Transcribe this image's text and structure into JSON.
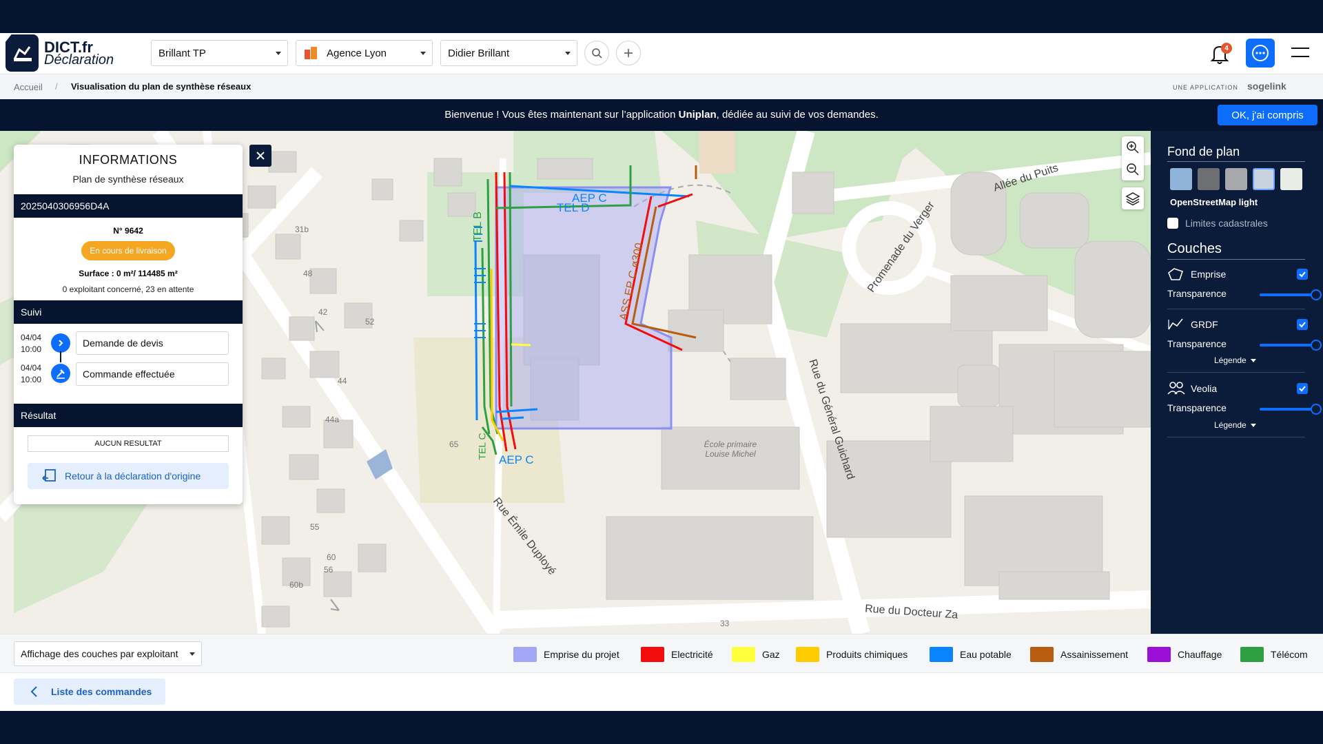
{
  "header": {
    "logo_title": "DICT.fr",
    "logo_subtitle": "Déclaration",
    "company_select": "Brillant TP",
    "agency_select": "Agence Lyon",
    "user_select": "Didier Brillant",
    "notification_count": "4"
  },
  "breadcrumb": {
    "home": "Accueil",
    "separator": "/",
    "current": "Visualisation du plan de synthèse réseaux",
    "app_prefix": "UNE APPLICATION",
    "brand": "sogelink"
  },
  "banner": {
    "message_before": "Bienvenue ! Vous êtes maintenant sur l’application ",
    "message_app": "Uniplan",
    "message_after": ", dédiée au suivi de vos demandes.",
    "ok_button": "OK, j'ai compris"
  },
  "map": {
    "street_labels": [
      "Allée du Puits",
      "Promenade du Verger",
      "Rue du Général Guichard",
      "Rue Émile Duployé",
      "Rue du Docteur Za"
    ],
    "poi_label": "École primaire Louise Michel",
    "building_numbers": [
      "31b",
      "48",
      "42",
      "52",
      "44",
      "44a",
      "55",
      "65",
      "56",
      "60",
      "60b",
      "33"
    ],
    "network_labels": [
      "AEP C",
      "TEL D",
      "TEL B",
      "ASS EP C ø300",
      "AEP C",
      "TEL C"
    ]
  },
  "info_panel": {
    "title": "INFORMATIONS",
    "subtitle": "Plan de synthèse réseaux",
    "reference": "2025040306956D4A",
    "number": "N° 9642",
    "status": "En cours de livraison",
    "status_color": "#f5a623",
    "surface": "Surface : 0 m²/ 114485 m²",
    "operators": "0 exploitant concerné, 23 en attente",
    "suivi_title": "Suivi",
    "timeline": [
      {
        "date": "04/04",
        "time": "10:00",
        "label": "Demande de devis"
      },
      {
        "date": "04/04",
        "time": "10:00",
        "label": "Commande effectuée"
      }
    ],
    "result_title": "Résultat",
    "result_value": "AUCUN RESULTAT",
    "back_button": "Retour à la déclaration d'origine"
  },
  "sidebar": {
    "basemap_title": "Fond de plan",
    "basemap_selected": "OpenStreetMap light",
    "cadastre_label": "Limites cadastrales",
    "layers_title": "Couches",
    "layers": [
      {
        "name": "Emprise",
        "checked": true,
        "transparency_label": "Transparence",
        "transparency": 1.0
      },
      {
        "name": "GRDF",
        "checked": true,
        "transparency_label": "Transparence",
        "transparency": 1.0,
        "legend": "Légende"
      },
      {
        "name": "Veolia",
        "checked": true,
        "transparency_label": "Transparence",
        "transparency": 1.0,
        "legend": "Légende"
      }
    ]
  },
  "legend_bar": {
    "display_select": "Affichage des couches par exploitant",
    "items": [
      {
        "label": "Emprise du projet",
        "color": "#a3a6f5"
      },
      {
        "label": "Electricité",
        "color": "#f40b0b"
      },
      {
        "label": "Gaz",
        "color": "#ffff3c"
      },
      {
        "label": "Produits chimiques",
        "color": "#ffcc00"
      },
      {
        "label": "Eau potable",
        "color": "#0a84ff"
      },
      {
        "label": "Assainissement",
        "color": "#b85c0f"
      },
      {
        "label": "Chauffage",
        "color": "#9b0fd6"
      },
      {
        "label": "Télécom",
        "color": "#2ea043"
      }
    ]
  },
  "footer": {
    "list_button": "Liste des commandes"
  }
}
